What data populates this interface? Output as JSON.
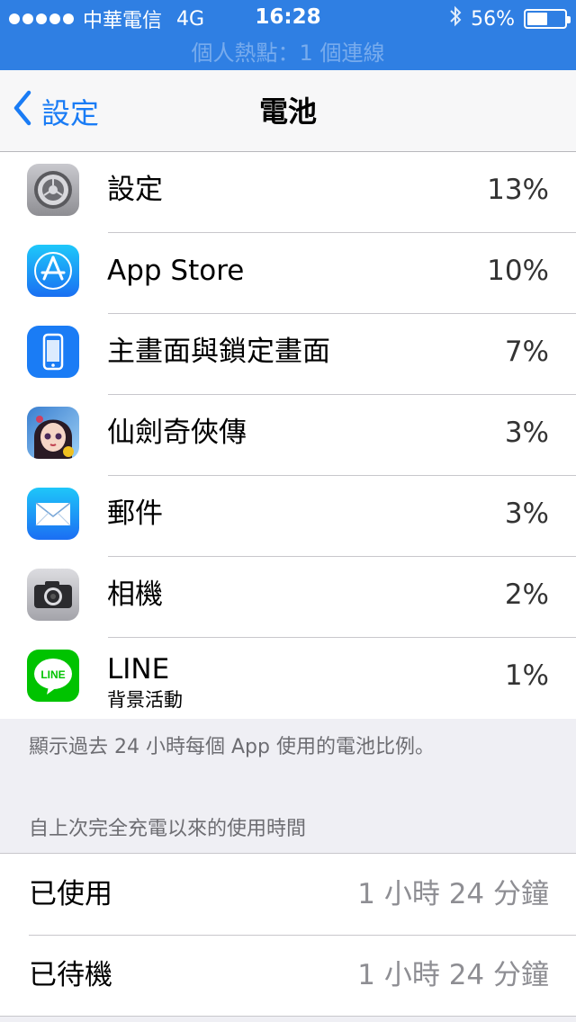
{
  "status_bar": {
    "carrier": "中華電信",
    "network": "4G",
    "time": "16:28",
    "battery_percent": "56%",
    "battery_level": 0.56
  },
  "hotspot_banner": "個人熱點：1 個連線",
  "nav": {
    "back_label": "設定",
    "title": "電池"
  },
  "apps": [
    {
      "name": "設定",
      "percent": "13%",
      "icon": "settings-gear-icon"
    },
    {
      "name": "App Store",
      "percent": "10%",
      "icon": "app-store-icon"
    },
    {
      "name": "主畫面與鎖定畫面",
      "percent": "7%",
      "icon": "phone-screen-icon"
    },
    {
      "name": "仙劍奇俠傳",
      "percent": "3%",
      "icon": "game-character-icon"
    },
    {
      "name": "郵件",
      "percent": "3%",
      "icon": "mail-envelope-icon"
    },
    {
      "name": "相機",
      "percent": "2%",
      "icon": "camera-icon"
    },
    {
      "name": "LINE",
      "subtitle": "背景活動",
      "percent": "1%",
      "icon": "line-app-icon"
    }
  ],
  "footnote": "顯示過去 24 小時每個 App 使用的電池比例。",
  "usage_section_header": "自上次完全充電以來的使用時間",
  "usage": [
    {
      "label": "已使用",
      "value": "1 小時 24 分鐘"
    },
    {
      "label": "已待機",
      "value": "1 小時 24 分鐘"
    }
  ],
  "colors": {
    "status_bar": "#2f7fe3",
    "accent": "#1a7cf5",
    "background": "#efeff4"
  }
}
